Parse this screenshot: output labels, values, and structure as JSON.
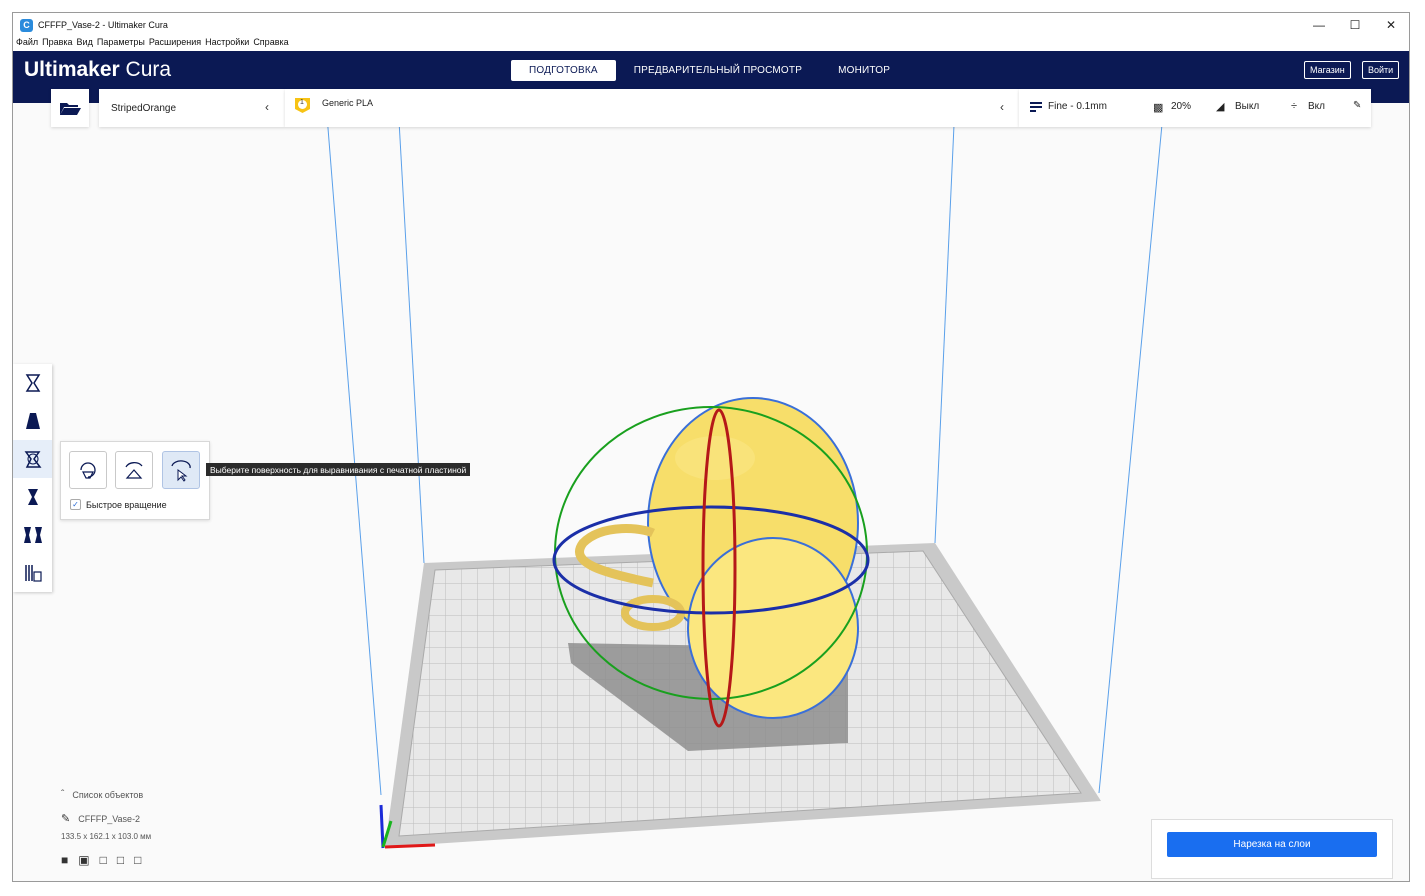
{
  "window": {
    "title": "CFFFP_Vase-2 - Ultimaker Cura"
  },
  "menu": [
    "Файл",
    "Правка",
    "Вид",
    "Параметры",
    "Расширения",
    "Настройки",
    "Справка"
  ],
  "header": {
    "logo_bold": "Ultimaker",
    "logo_light": " Cura",
    "tabs": [
      {
        "label": "ПОДГОТОВКА",
        "active": true
      },
      {
        "label": "ПРЕДВАРИТЕЛЬНЫЙ ПРОСМОТР",
        "active": false
      },
      {
        "label": "МОНИТОР",
        "active": false
      }
    ],
    "marketplace": "Магазин",
    "signin": "Войти"
  },
  "printer": {
    "name": "StripedOrange"
  },
  "material": {
    "badge": "1",
    "name": "Generic PLA",
    "accent": "#f7c315"
  },
  "print_settings": {
    "profile": "Fine - 0.1mm",
    "infill": "20%",
    "support": "Выкл",
    "adhesion": "Вкл"
  },
  "rotate_tool": {
    "tooltip": "Выберите поверхность для выравнивания с печатной пластиной",
    "snap_label": "Быстрое вращение",
    "snap_checked": true
  },
  "object_list": {
    "header": "Список объектов",
    "object_name": "CFFFP_Vase-2",
    "dimensions": "133.5 x 162.1 x 103.0 мм"
  },
  "slice": {
    "label": "Нарезка на слои",
    "color": "#196ef0"
  }
}
